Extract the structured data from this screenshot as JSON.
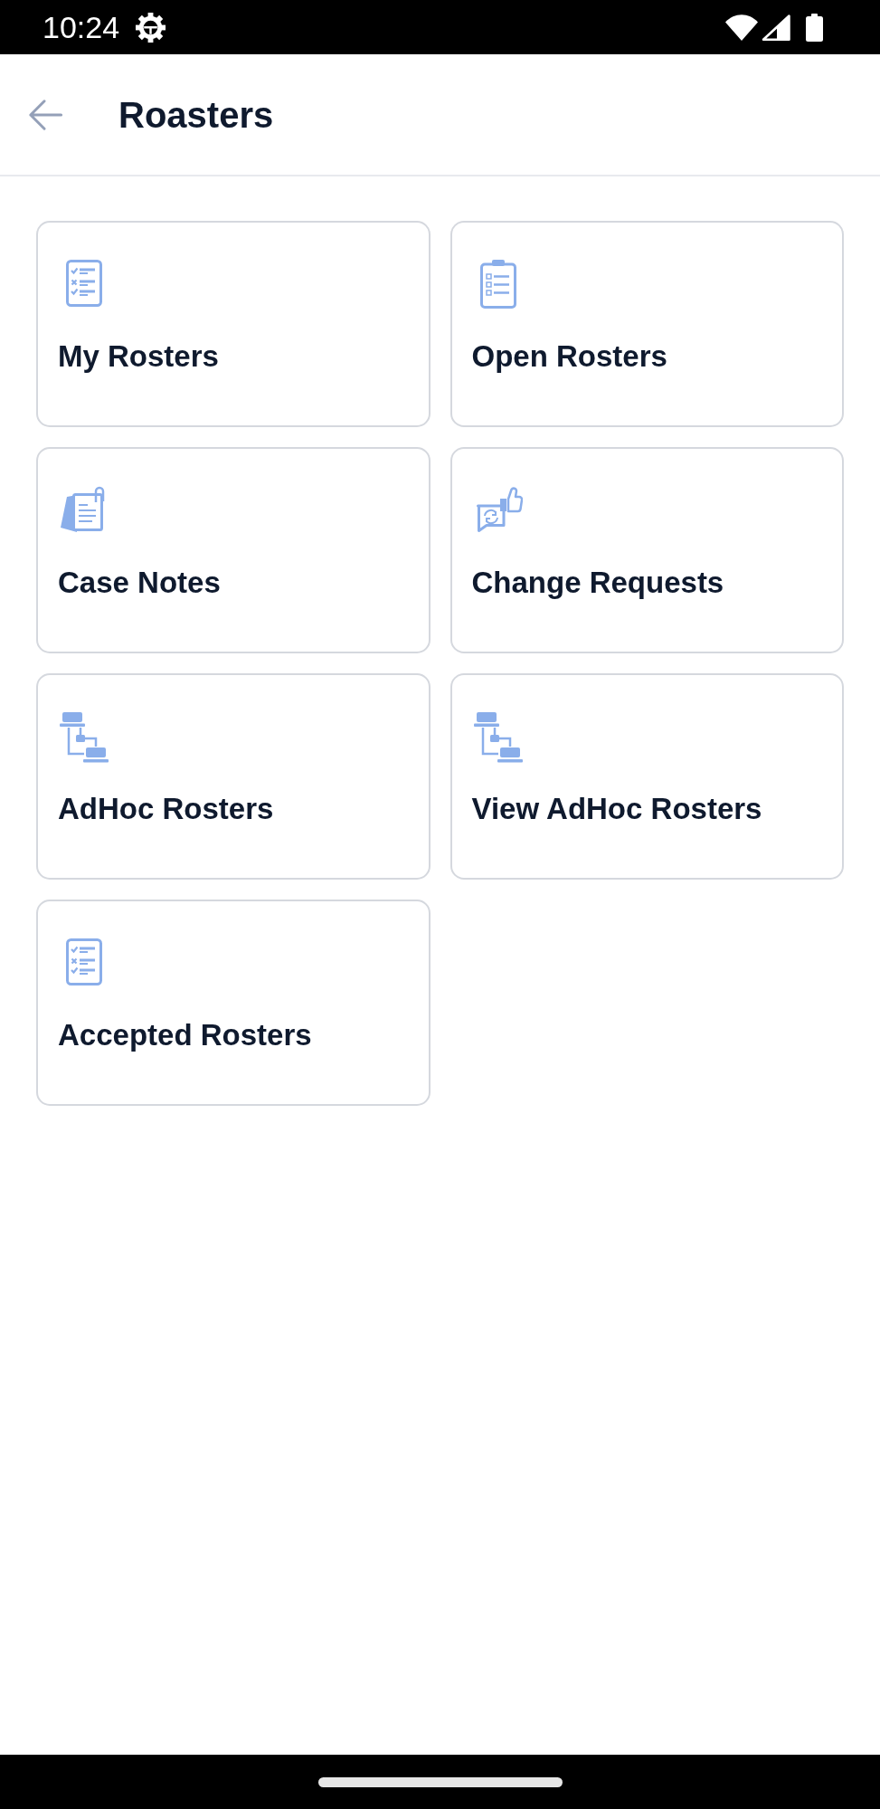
{
  "status_bar": {
    "time": "10:24"
  },
  "header": {
    "title": "Roasters"
  },
  "tiles": [
    {
      "label": "My Rosters",
      "kind": "checklist"
    },
    {
      "label": "Open Rosters",
      "kind": "clipboard"
    },
    {
      "label": "Case Notes",
      "kind": "notepad"
    },
    {
      "label": "Change Requests",
      "kind": "feedback"
    },
    {
      "label": "AdHoc Rosters",
      "kind": "network"
    },
    {
      "label": "View AdHoc Rosters",
      "kind": "network"
    },
    {
      "label": "Accepted Rosters",
      "kind": "checklist"
    }
  ]
}
